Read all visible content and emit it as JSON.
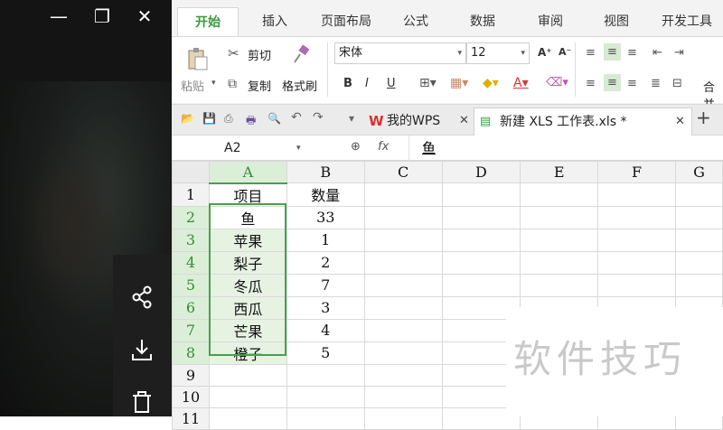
{
  "window_controls": {
    "minimize": "—",
    "restore": "❐",
    "close": "✕"
  },
  "side_actions": [
    {
      "icon": "share-icon"
    },
    {
      "icon": "download-icon"
    },
    {
      "icon": "delete-icon"
    }
  ],
  "ribbon": {
    "tabs": [
      "开始",
      "插入",
      "页面布局",
      "公式",
      "数据",
      "审阅",
      "视图",
      "开发工具"
    ],
    "active_tab": "开始",
    "clipboard": {
      "paste": "粘贴",
      "cut": "剪切",
      "copy": "复制",
      "format_painter": "格式刷"
    },
    "font": {
      "name": "宋体",
      "size": "12"
    },
    "merge_label": "合并"
  },
  "doc_tabs": [
    {
      "label": "我的WPS",
      "icon": "wps-icon"
    },
    {
      "label": "新建 XLS 工作表.xls *",
      "icon": "sheet-file-icon"
    }
  ],
  "formula_bar": {
    "cell_ref": "A2",
    "fx": "fx",
    "value": "鱼"
  },
  "sheet": {
    "columns": [
      "A",
      "B",
      "C",
      "D",
      "E",
      "F",
      "G"
    ],
    "selected_column": "A",
    "rows": [
      {
        "num": "1",
        "cells": [
          "项目",
          "数量"
        ]
      },
      {
        "num": "2",
        "cells": [
          "鱼",
          "33"
        ]
      },
      {
        "num": "3",
        "cells": [
          "苹果",
          "1"
        ]
      },
      {
        "num": "4",
        "cells": [
          "梨子",
          "2"
        ]
      },
      {
        "num": "5",
        "cells": [
          "冬瓜",
          "7"
        ]
      },
      {
        "num": "6",
        "cells": [
          "西瓜",
          "3"
        ]
      },
      {
        "num": "7",
        "cells": [
          "芒果",
          "4"
        ]
      },
      {
        "num": "8",
        "cells": [
          "橙子",
          "5"
        ]
      },
      {
        "num": "9",
        "cells": [
          "",
          ""
        ]
      },
      {
        "num": "10",
        "cells": [
          "",
          ""
        ]
      },
      {
        "num": "11",
        "cells": [
          "",
          ""
        ]
      }
    ]
  },
  "watermark": "软件技巧",
  "colors": {
    "accent": "#3a9a3a",
    "selection": "#e6f3e3",
    "wps_red": "#d9302c"
  }
}
